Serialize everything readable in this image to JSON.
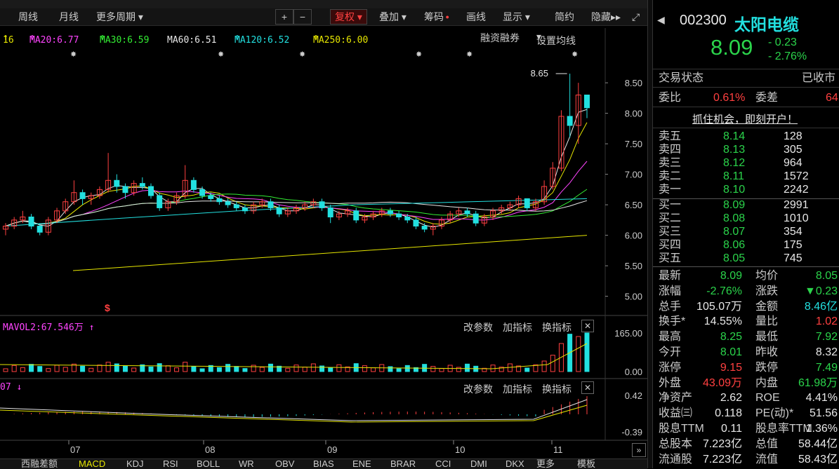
{
  "periodbar": {
    "items": [
      "周线",
      "月线",
      "更多周期"
    ],
    "tools": [
      "复权",
      "叠加",
      "筹码",
      "画线",
      "显示",
      "简约",
      "隐藏"
    ],
    "top_right_btns": [
      "融资融券",
      "设置均线"
    ]
  },
  "ma": {
    "first": "16",
    "ma20": "MA20:6.77",
    "ma30": "MA30:6.59",
    "ma60": "MA60:6.51",
    "ma120": "MA120:6.52",
    "ma250": "MA250:6.00"
  },
  "chart_data": [
    {
      "type": "candlestick",
      "title": "",
      "y_ticks": [
        "8.50",
        "8.00",
        "7.50",
        "7.00",
        "6.50",
        "6.00",
        "5.50",
        "5.00"
      ],
      "ylim": [
        4.8,
        8.8
      ],
      "x_labels": [
        "07",
        "08",
        "09",
        "10",
        "11"
      ],
      "annotation": "8.65",
      "candles": [
        [
          6.1,
          6.2,
          6.0,
          6.15
        ],
        [
          6.15,
          6.3,
          6.1,
          6.25
        ],
        [
          6.25,
          6.4,
          6.2,
          6.3
        ],
        [
          6.3,
          6.35,
          6.1,
          6.15
        ],
        [
          6.15,
          6.2,
          6.0,
          6.05
        ],
        [
          6.05,
          6.3,
          6.0,
          6.25
        ],
        [
          6.25,
          6.45,
          6.2,
          6.4
        ],
        [
          6.4,
          6.6,
          6.35,
          6.55
        ],
        [
          6.55,
          6.9,
          6.5,
          6.7
        ],
        [
          6.7,
          6.75,
          6.5,
          6.6
        ],
        [
          6.6,
          6.7,
          6.5,
          6.65
        ],
        [
          6.65,
          6.8,
          6.6,
          6.75
        ],
        [
          6.75,
          7.35,
          6.7,
          6.9
        ],
        [
          6.9,
          7.0,
          6.7,
          6.8
        ],
        [
          6.8,
          6.85,
          6.6,
          6.7
        ],
        [
          6.7,
          6.9,
          6.65,
          6.85
        ],
        [
          6.85,
          6.95,
          6.75,
          6.8
        ],
        [
          6.8,
          6.85,
          6.6,
          6.65
        ],
        [
          6.65,
          6.7,
          6.4,
          6.45
        ],
        [
          6.45,
          6.6,
          6.4,
          6.55
        ],
        [
          6.55,
          6.7,
          6.5,
          6.65
        ],
        [
          6.65,
          7.15,
          6.6,
          6.9
        ],
        [
          6.9,
          6.95,
          6.7,
          6.75
        ],
        [
          6.75,
          6.8,
          6.6,
          6.65
        ],
        [
          6.65,
          6.7,
          6.55,
          6.6
        ],
        [
          6.6,
          6.65,
          6.5,
          6.55
        ],
        [
          6.55,
          6.6,
          6.45,
          6.5
        ],
        [
          6.5,
          6.55,
          6.4,
          6.45
        ],
        [
          6.45,
          6.5,
          6.35,
          6.4
        ],
        [
          6.4,
          6.55,
          6.35,
          6.5
        ],
        [
          6.5,
          6.6,
          6.45,
          6.55
        ],
        [
          6.55,
          6.6,
          6.4,
          6.45
        ],
        [
          6.45,
          6.5,
          6.3,
          6.35
        ],
        [
          6.35,
          6.45,
          6.3,
          6.4
        ],
        [
          6.4,
          6.5,
          6.35,
          6.45
        ],
        [
          6.45,
          6.55,
          6.4,
          6.5
        ],
        [
          6.5,
          6.6,
          6.45,
          6.55
        ],
        [
          6.55,
          6.6,
          6.4,
          6.45
        ],
        [
          6.45,
          6.5,
          6.2,
          6.3
        ],
        [
          6.3,
          6.4,
          6.25,
          6.35
        ],
        [
          6.35,
          6.45,
          6.3,
          6.4
        ],
        [
          6.4,
          6.45,
          6.2,
          6.25
        ],
        [
          6.25,
          6.35,
          6.2,
          6.3
        ],
        [
          6.3,
          6.4,
          6.25,
          6.35
        ],
        [
          6.35,
          6.45,
          6.3,
          6.4
        ],
        [
          6.4,
          6.45,
          6.3,
          6.35
        ],
        [
          6.35,
          6.4,
          6.25,
          6.3
        ],
        [
          6.3,
          6.35,
          6.2,
          6.25
        ],
        [
          6.25,
          6.3,
          6.1,
          6.15
        ],
        [
          6.15,
          6.2,
          6.05,
          6.1
        ],
        [
          6.1,
          6.2,
          6.0,
          6.15
        ],
        [
          6.15,
          6.3,
          6.1,
          6.25
        ],
        [
          6.25,
          6.4,
          6.2,
          6.35
        ],
        [
          6.35,
          6.45,
          6.3,
          6.4
        ],
        [
          6.4,
          6.45,
          6.3,
          6.35
        ],
        [
          6.35,
          6.4,
          6.15,
          6.2
        ],
        [
          6.2,
          6.35,
          6.15,
          6.3
        ],
        [
          6.3,
          6.45,
          6.25,
          6.4
        ],
        [
          6.4,
          6.5,
          6.35,
          6.45
        ],
        [
          6.45,
          6.55,
          6.4,
          6.5
        ],
        [
          6.5,
          6.65,
          6.45,
          6.6
        ],
        [
          6.6,
          6.5,
          6.4,
          6.45
        ],
        [
          6.45,
          6.6,
          6.4,
          6.55
        ],
        [
          6.55,
          6.9,
          6.5,
          6.8
        ],
        [
          6.8,
          7.2,
          6.75,
          7.1
        ],
        [
          7.1,
          8.05,
          7.05,
          7.95
        ],
        [
          7.95,
          8.65,
          7.6,
          7.8
        ],
        [
          7.8,
          8.5,
          7.5,
          8.3
        ],
        [
          8.3,
          8.25,
          7.92,
          8.09
        ]
      ]
    },
    {
      "type": "bar",
      "title": "MAVOL2:67.546万",
      "y_ticks": [
        "165.00",
        "0.00"
      ],
      "ylim": [
        0,
        180
      ]
    },
    {
      "type": "line",
      "title": "",
      "y_ticks": [
        "0.42",
        "-0.39"
      ],
      "ylim": [
        -0.45,
        0.48
      ]
    }
  ],
  "subpanel": {
    "btns": [
      "改参数",
      "加指标",
      "换指标"
    ]
  },
  "stock": {
    "code": "002300",
    "name": "太阳电缆",
    "price": "8.09",
    "change": "- 0.23",
    "pct": "- 2.76%",
    "status_label": "交易状态",
    "status_value": "已收市",
    "weibi_label": "委比",
    "weibi_value": "0.61%",
    "weicha_label": "委差",
    "weicha_value": "64",
    "promo": "抓住机会，即刻开户！"
  },
  "asks": [
    {
      "label": "卖五",
      "price": "8.14",
      "vol": "128"
    },
    {
      "label": "卖四",
      "price": "8.13",
      "vol": "305"
    },
    {
      "label": "卖三",
      "price": "8.12",
      "vol": "964"
    },
    {
      "label": "卖二",
      "price": "8.11",
      "vol": "1572"
    },
    {
      "label": "卖一",
      "price": "8.10",
      "vol": "2242"
    }
  ],
  "bids": [
    {
      "label": "买一",
      "price": "8.09",
      "vol": "2991"
    },
    {
      "label": "买二",
      "price": "8.08",
      "vol": "1010"
    },
    {
      "label": "买三",
      "price": "8.07",
      "vol": "354"
    },
    {
      "label": "买四",
      "price": "8.06",
      "vol": "175"
    },
    {
      "label": "买五",
      "price": "8.05",
      "vol": "745"
    }
  ],
  "stats": [
    {
      "l1": "最新",
      "v1": "8.09",
      "c1": "green",
      "l2": "均价",
      "v2": "8.05",
      "c2": "green"
    },
    {
      "l1": "涨幅",
      "v1": "-2.76%",
      "c1": "green",
      "l2": "涨跌",
      "v2": "▼0.23",
      "c2": "green"
    },
    {
      "l1": "总手",
      "v1": "105.07万",
      "c1": "white",
      "l2": "金额",
      "v2": "8.46亿",
      "c2": "cyan"
    },
    {
      "l1": "换手*",
      "v1": "14.55%",
      "c1": "white",
      "l2": "量比",
      "v2": "1.02",
      "c2": "red"
    },
    {
      "l1": "最高",
      "v1": "8.25",
      "c1": "green",
      "l2": "最低",
      "v2": "7.92",
      "c2": "green"
    },
    {
      "l1": "今开",
      "v1": "8.01",
      "c1": "green",
      "l2": "昨收",
      "v2": "8.32",
      "c2": "white"
    },
    {
      "l1": "涨停",
      "v1": "9.15",
      "c1": "red",
      "l2": "跌停",
      "v2": "7.49",
      "c2": "green"
    },
    {
      "l1": "外盘",
      "v1": "43.09万",
      "c1": "red",
      "l2": "内盘",
      "v2": "61.98万",
      "c2": "green"
    },
    {
      "l1": "净资产",
      "v1": "2.62",
      "c1": "white",
      "l2": "ROE",
      "v2": "4.41%",
      "c2": "white"
    },
    {
      "l1": "收益㈢",
      "v1": "0.118",
      "c1": "white",
      "l2": "PE(动)*",
      "v2": "51.56",
      "c2": "white"
    },
    {
      "l1": "股息TTM",
      "v1": "0.11",
      "c1": "white",
      "l2": "股息率TTM",
      "v2": "1.36%",
      "c2": "white"
    },
    {
      "l1": "总股本",
      "v1": "7.223亿",
      "c1": "white",
      "l2": "总值",
      "v2": "58.44亿",
      "c2": "white"
    },
    {
      "l1": "流通股",
      "v1": "7.223亿",
      "c1": "white",
      "l2": "流值",
      "v2": "58.43亿",
      "c2": "white"
    }
  ],
  "bottom_tabs": [
    "西融差额",
    "MACD",
    "KDJ",
    "RSI",
    "BOLL",
    "WR",
    "OBV",
    "BIAS",
    "ENE",
    "BRAR",
    "CCI",
    "DMI",
    "DKX",
    "更多",
    "模板"
  ],
  "colors": {
    "up": "#ff4040",
    "down": "#2bd44b",
    "cyan": "#22e0e0",
    "bg": "#000000"
  }
}
